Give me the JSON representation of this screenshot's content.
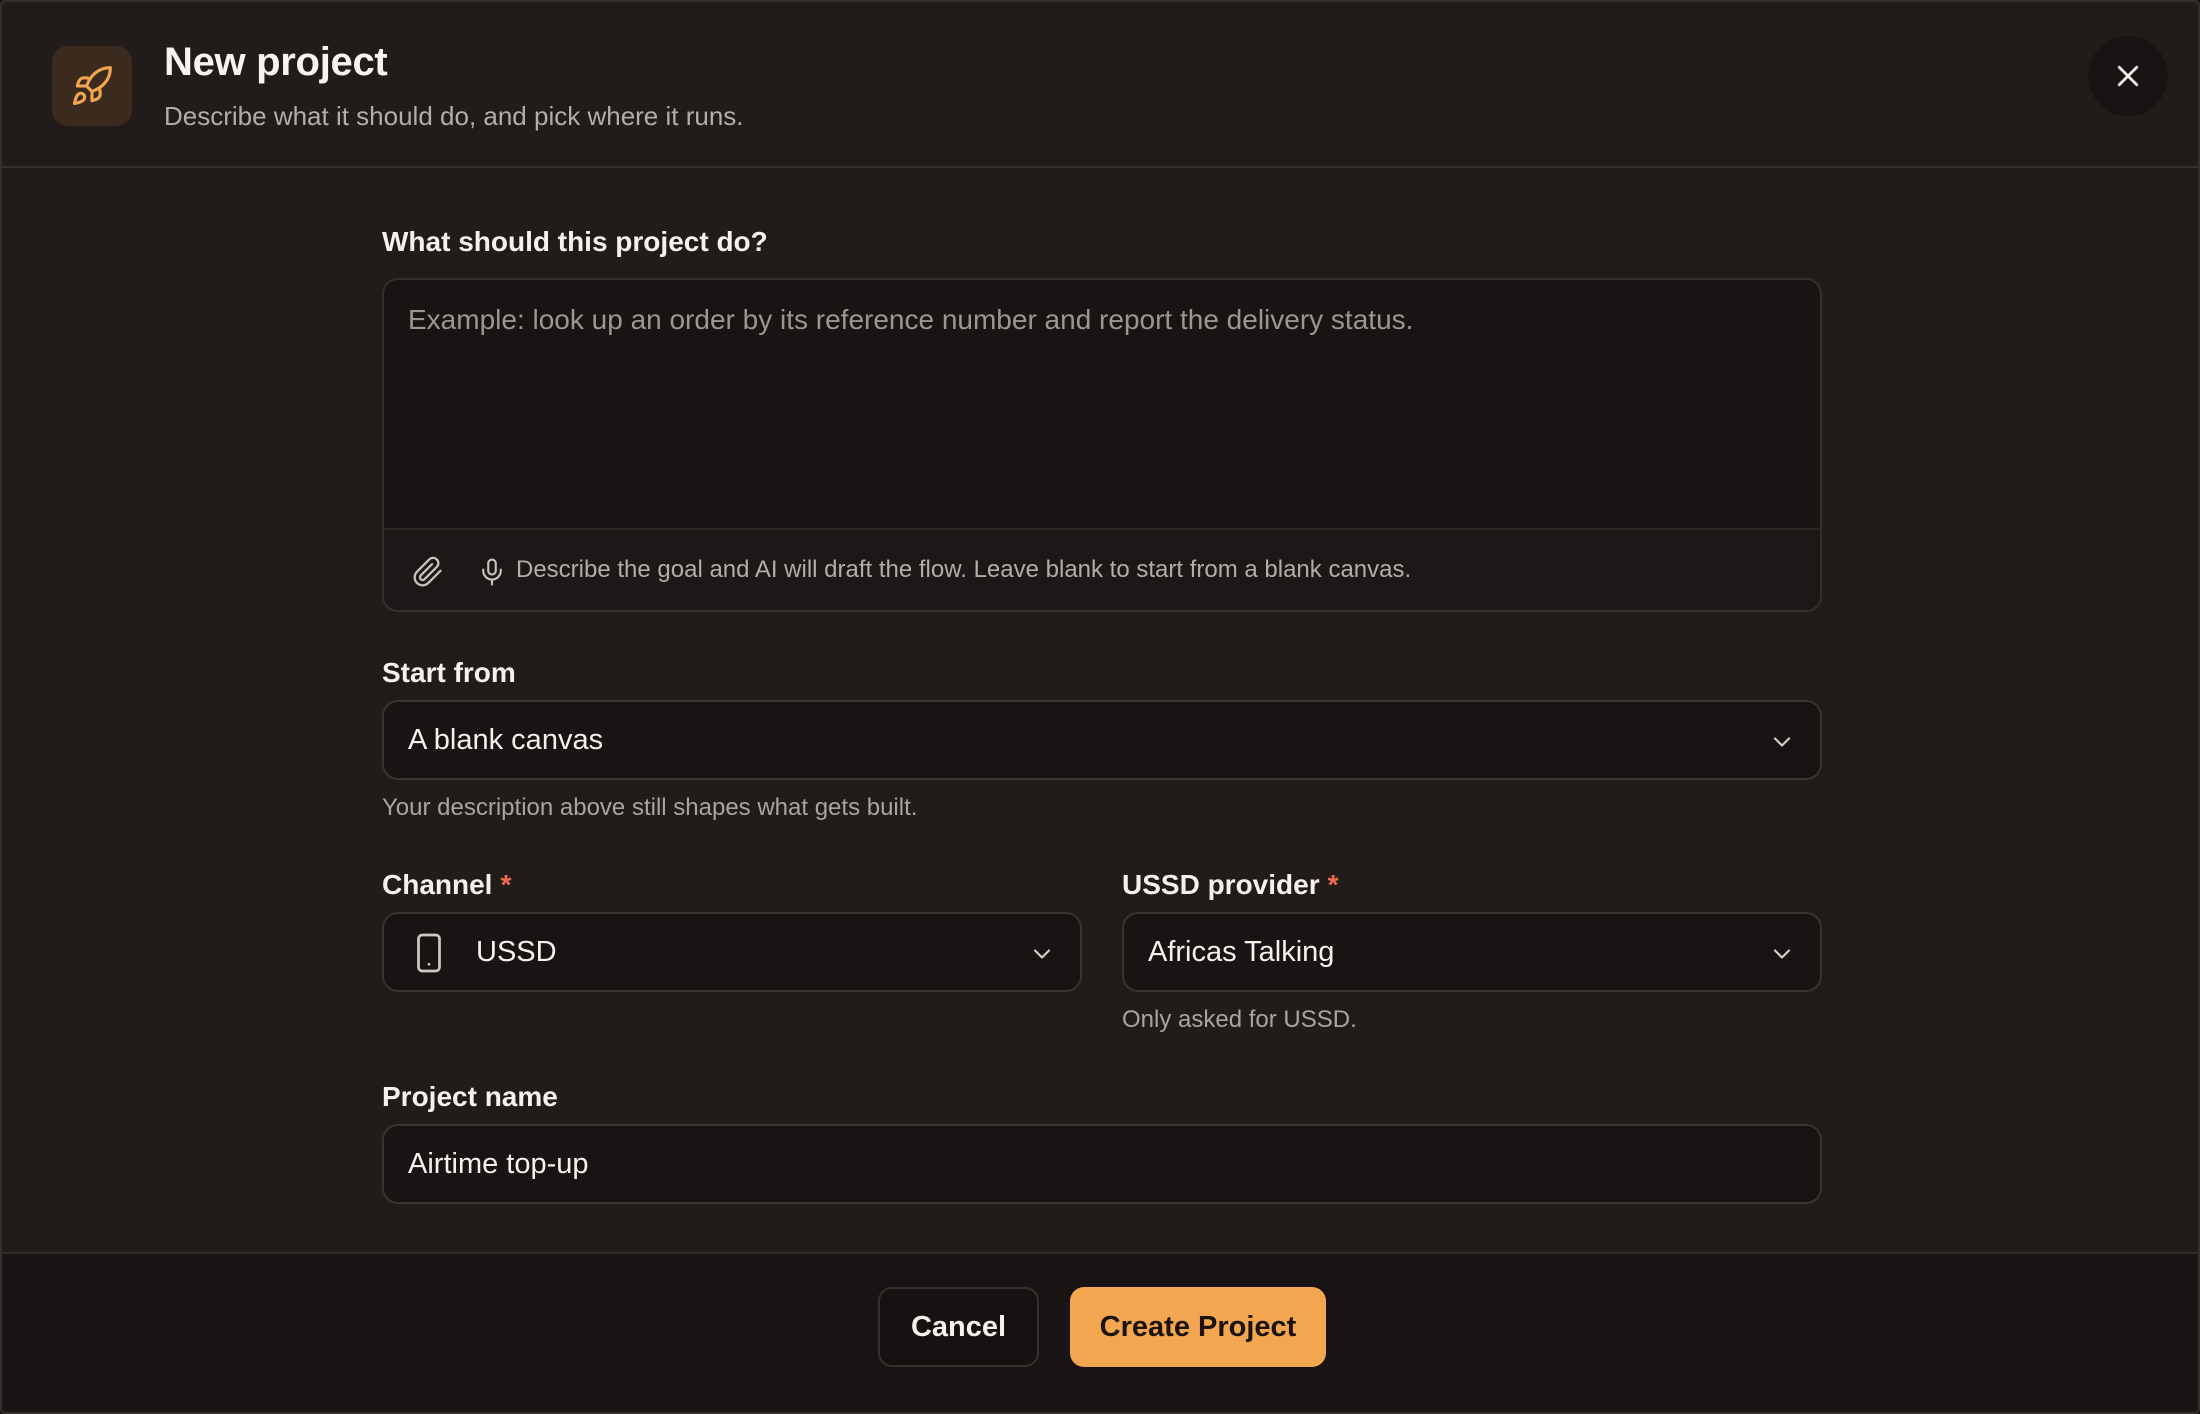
{
  "header": {
    "title": "New project",
    "subtitle": "Describe what it should do, and pick where it runs.",
    "icon": "rocket-icon",
    "accent_color": "#f3a650"
  },
  "description": {
    "label": "What should this project do?",
    "value": "",
    "placeholder": "Example: look up an order by its reference number and report the delivery status.",
    "hint": "Describe the goal and AI will draft the flow. Leave blank to start from a blank canvas.",
    "tools": [
      "paperclip-icon",
      "microphone-icon"
    ]
  },
  "start_from": {
    "label": "Start from",
    "value": "A blank canvas",
    "help": "Your description above still shapes what gets built."
  },
  "channel": {
    "label": "Channel",
    "required_mark": "*",
    "value": "USSD",
    "icon": "phone-icon"
  },
  "ussd_provider": {
    "label": "USSD provider",
    "required_mark": "*",
    "value": "Africas Talking",
    "help": "Only asked for USSD."
  },
  "project_name": {
    "label": "Project name",
    "value": "Airtime top-up"
  },
  "actions": {
    "cancel": "Cancel",
    "create": "Create Project"
  }
}
